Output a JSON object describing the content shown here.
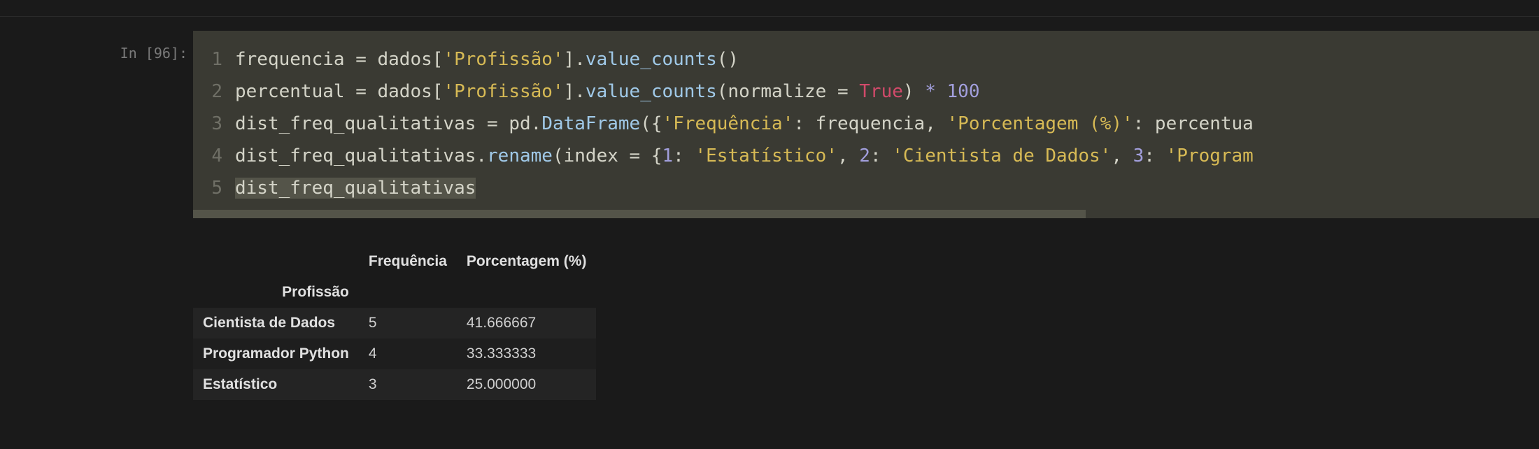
{
  "prompt": "In [96]:",
  "code": {
    "lines": [
      {
        "n": "1",
        "segs": [
          {
            "t": "frequencia ",
            "c": "tok-ident"
          },
          {
            "t": "= ",
            "c": "tok-op"
          },
          {
            "t": "dados[",
            "c": "tok-ident"
          },
          {
            "t": "'Profissão'",
            "c": "tok-str"
          },
          {
            "t": "].",
            "c": "tok-punct"
          },
          {
            "t": "value_counts",
            "c": "tok-method"
          },
          {
            "t": "()",
            "c": "tok-punct"
          }
        ]
      },
      {
        "n": "2",
        "segs": [
          {
            "t": "percentual ",
            "c": "tok-ident"
          },
          {
            "t": "= ",
            "c": "tok-op"
          },
          {
            "t": "dados[",
            "c": "tok-ident"
          },
          {
            "t": "'Profissão'",
            "c": "tok-str"
          },
          {
            "t": "].",
            "c": "tok-punct"
          },
          {
            "t": "value_counts",
            "c": "tok-method"
          },
          {
            "t": "(normalize ",
            "c": "tok-ident"
          },
          {
            "t": "= ",
            "c": "tok-op"
          },
          {
            "t": "True",
            "c": "tok-true"
          },
          {
            "t": ") ",
            "c": "tok-punct"
          },
          {
            "t": "* ",
            "c": "tok-star"
          },
          {
            "t": "100",
            "c": "tok-num"
          }
        ]
      },
      {
        "n": "3",
        "segs": [
          {
            "t": "dist_freq_qualitativas ",
            "c": "tok-ident"
          },
          {
            "t": "= ",
            "c": "tok-op"
          },
          {
            "t": "pd.",
            "c": "tok-ident"
          },
          {
            "t": "DataFrame",
            "c": "tok-method"
          },
          {
            "t": "({",
            "c": "tok-punct"
          },
          {
            "t": "'Frequência'",
            "c": "tok-str"
          },
          {
            "t": ": frequencia, ",
            "c": "tok-ident"
          },
          {
            "t": "'Porcentagem (%)'",
            "c": "tok-str"
          },
          {
            "t": ": percentua",
            "c": "tok-ident"
          }
        ]
      },
      {
        "n": "4",
        "segs": [
          {
            "t": "dist_freq_qualitativas.",
            "c": "tok-ident"
          },
          {
            "t": "rename",
            "c": "tok-method"
          },
          {
            "t": "(index ",
            "c": "tok-ident"
          },
          {
            "t": "= ",
            "c": "tok-op"
          },
          {
            "t": "{",
            "c": "tok-punct"
          },
          {
            "t": "1",
            "c": "tok-num"
          },
          {
            "t": ": ",
            "c": "tok-punct"
          },
          {
            "t": "'Estatístico'",
            "c": "tok-str"
          },
          {
            "t": ", ",
            "c": "tok-punct"
          },
          {
            "t": "2",
            "c": "tok-num"
          },
          {
            "t": ": ",
            "c": "tok-punct"
          },
          {
            "t": "'Cientista de Dados'",
            "c": "tok-str"
          },
          {
            "t": ", ",
            "c": "tok-punct"
          },
          {
            "t": "3",
            "c": "tok-num"
          },
          {
            "t": ": ",
            "c": "tok-punct"
          },
          {
            "t": "'Program",
            "c": "tok-str"
          }
        ]
      },
      {
        "n": "5",
        "segs": [
          {
            "t": "dist_freq_qualitativas",
            "c": "tok-ident",
            "sel": true
          }
        ]
      }
    ]
  },
  "output_table": {
    "index_name": "Profissão",
    "columns": [
      "Frequência",
      "Porcentagem (%)"
    ],
    "rows": [
      {
        "idx": "Cientista de Dados",
        "vals": [
          "5",
          "41.666667"
        ]
      },
      {
        "idx": "Programador Python",
        "vals": [
          "4",
          "33.333333"
        ]
      },
      {
        "idx": "Estatístico",
        "vals": [
          "3",
          "25.000000"
        ]
      }
    ]
  }
}
